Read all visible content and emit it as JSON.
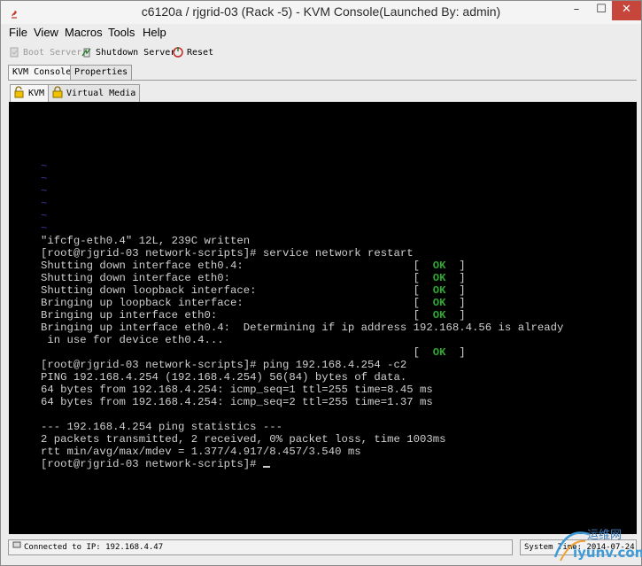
{
  "window": {
    "title": "c6120a / rjgrid-03 (Rack -5) - KVM Console(Launched By: admin)"
  },
  "window_controls": {
    "minimize": "–",
    "maximize": "☐",
    "close": "✕"
  },
  "menu": [
    "File",
    "View",
    "Macros",
    "Tools",
    "Help"
  ],
  "toolbar": {
    "boot_server": "Boot Server",
    "shutdown_server": "Shutdown Server",
    "reset": "Reset"
  },
  "outer_tabs": [
    "KVM Console",
    "Properties"
  ],
  "inner_tabs": [
    "KVM",
    "Virtual Media"
  ],
  "terminal": {
    "lines": [
      {
        "text": "~",
        "kind": "tilde"
      },
      {
        "text": "~",
        "kind": "tilde"
      },
      {
        "text": "~",
        "kind": "tilde"
      },
      {
        "text": "~",
        "kind": "tilde"
      },
      {
        "text": "~",
        "kind": "tilde"
      },
      {
        "text": "~",
        "kind": "tilde"
      },
      {
        "text": "\"ifcfg-eth0.4\" 12L, 239C written"
      },
      {
        "text": "[root@rjgrid-03 network-scripts]# service network restart"
      },
      {
        "text": "Shutting down interface eth0.4:                          ",
        "status": "OK"
      },
      {
        "text": "Shutting down interface eth0:                            ",
        "status": "OK"
      },
      {
        "text": "Shutting down loopback interface:                        ",
        "status": "OK"
      },
      {
        "text": "Bringing up loopback interface:                          ",
        "status": "OK"
      },
      {
        "text": "Bringing up interface eth0:                              ",
        "status": "OK"
      },
      {
        "text": "Bringing up interface eth0.4:  Determining if ip address 192.168.4.56 is already"
      },
      {
        "text": " in use for device eth0.4..."
      },
      {
        "text": "                                                         ",
        "status": "OK"
      },
      {
        "text": "[root@rjgrid-03 network-scripts]# ping 192.168.4.254 -c2"
      },
      {
        "text": "PING 192.168.4.254 (192.168.4.254) 56(84) bytes of data."
      },
      {
        "text": "64 bytes from 192.168.4.254: icmp_seq=1 ttl=255 time=8.45 ms"
      },
      {
        "text": "64 bytes from 192.168.4.254: icmp_seq=2 ttl=255 time=1.37 ms"
      },
      {
        "text": ""
      },
      {
        "text": "--- 192.168.4.254 ping statistics ---"
      },
      {
        "text": "2 packets transmitted, 2 received, 0% packet loss, time 1003ms"
      },
      {
        "text": "rtt min/avg/max/mdev = 1.377/4.917/8.457/3.540 ms"
      },
      {
        "text": "[root@rjgrid-03 network-scripts]# ",
        "cursor": true
      }
    ],
    "ok_label": "OK"
  },
  "status": {
    "connected": "Connected to IP: 192.168.4.47",
    "system_time": "System Time: 2014-07-24"
  },
  "watermark": {
    "cn": "运维网",
    "en": "iyunv.com"
  },
  "colors": {
    "console_bg": "#000000",
    "console_text": "#cfcfcf",
    "ok_green": "#2ea82e",
    "tilde_blue": "#3a3aa0",
    "close_red": "#c7463c"
  }
}
